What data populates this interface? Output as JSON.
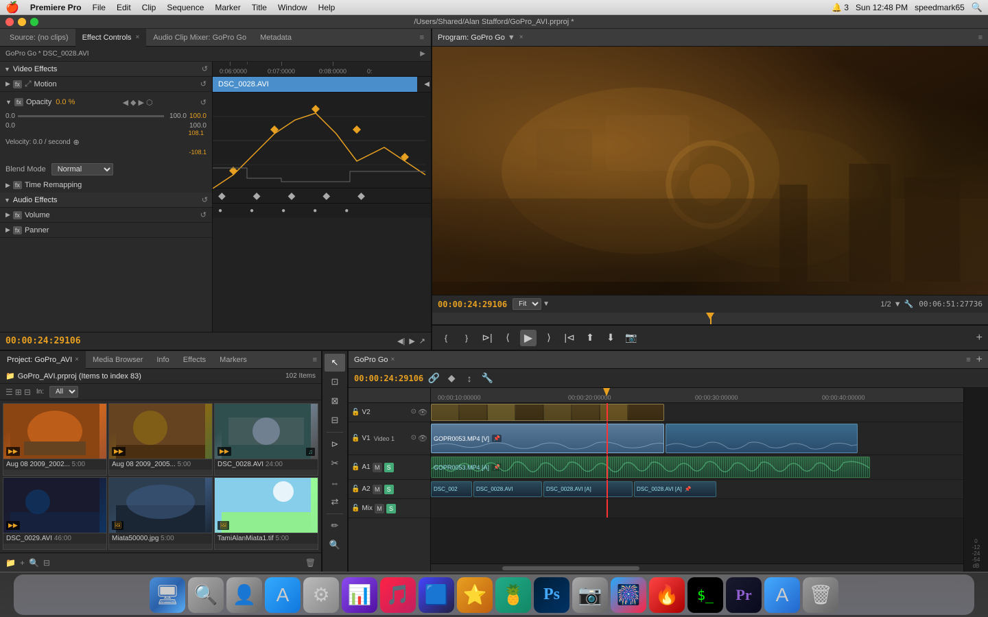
{
  "app": {
    "name": "Premiere Pro",
    "title_bar": "/Users/Shared/Alan Stafford/GoPro_AVI.prproj *",
    "time": "Sun 12:48 PM",
    "user": "speedmark65"
  },
  "menu": {
    "apple": "🍎",
    "items": [
      "Premiere Pro",
      "File",
      "Edit",
      "Clip",
      "Sequence",
      "Marker",
      "Title",
      "Window",
      "Help"
    ]
  },
  "effect_controls": {
    "tab_label": "Effect Controls",
    "tab_close": "×",
    "other_tabs": [
      "Source: (no clips)",
      "Audio Clip Mixer: GoPro Go",
      "Metadata"
    ],
    "source_label": "Source: (no clips)",
    "clip_name": "GoPro Go * DSC_0028.AVI",
    "timeline_clip": "DSC_0028.AVI",
    "video_effects_label": "Video Effects",
    "motion_label": "Motion",
    "opacity_label": "Opacity",
    "opacity_value": "0.0 %",
    "range_min": "0.0",
    "range_max": "100.0",
    "graph_max": "100.0",
    "graph_108": "108.1",
    "graph_neg108": "-108.1",
    "velocity_label": "Velocity: 0.0 / second",
    "blend_mode_label": "Blend Mode",
    "blend_mode_value": "Normal",
    "time_remap_label": "Time Remapping",
    "audio_effects_label": "Audio Effects",
    "volume_label": "Volume",
    "panner_label": "Panner",
    "timecode": "00:00:24:29106"
  },
  "program_monitor": {
    "title": "Program: GoPro Go",
    "timecode": "00:00:24:29106",
    "fit_label": "Fit",
    "fraction": "1/2",
    "duration": "00:06:51:27736"
  },
  "project": {
    "tab_label": "Project: GoPro_AVI",
    "tab_close": "×",
    "other_tabs": [
      "Media Browser",
      "Info",
      "Effects",
      "Markers"
    ],
    "project_name": "GoPro_AVI.prproj (Items to index 83)",
    "items_count": "102 Items",
    "in_label": "In:",
    "in_value": "All",
    "media_items": [
      {
        "name": "Aug 08 2009_2002...",
        "duration": "5:00",
        "thumb": "1",
        "has_audio": true
      },
      {
        "name": "Aug 08 2009_2005...",
        "duration": "5:00",
        "thumb": "2",
        "has_audio": true
      },
      {
        "name": "DSC_0028.AVI",
        "duration": "24:00",
        "thumb": "3",
        "has_audio": false
      },
      {
        "name": "DSC_0029.AVI",
        "duration": "46:00",
        "thumb": "4",
        "has_audio": false
      },
      {
        "name": "Miata50000.jpg",
        "duration": "5:00",
        "thumb": "5",
        "has_audio": false
      },
      {
        "name": "TamiAlanMiata1.tif",
        "duration": "5:00",
        "thumb": "6",
        "has_audio": false
      }
    ]
  },
  "timeline": {
    "tab_label": "GoPro Go",
    "tab_close": "×",
    "timecode": "00:00:24:29106",
    "ruler_marks": [
      "00:00:10:00000",
      "00:00:20:00000",
      "00:00:30:00000",
      "00:00:40:00000"
    ],
    "tracks": {
      "v2_label": "V2",
      "v1_label": "V1",
      "video1_label": "Video 1",
      "a1_label": "A1",
      "a2_label": "A2"
    },
    "clips": {
      "v1_main": "GOPR0053.MP4 [V]",
      "a1_main": "GOPR0053.MP4 [A]",
      "a2_clips": [
        "DSC_002",
        "DSC_0028.AVI",
        "DSC_0028.AVI [A]",
        "DSC_0028.AVI [A]"
      ]
    }
  },
  "tools": [
    "arrow",
    "select",
    "ripple",
    "roll",
    "rate",
    "razor",
    "slip",
    "slide",
    "pen",
    "zoom"
  ],
  "dock_apps": [
    {
      "name": "Finder",
      "icon": "🖥"
    },
    {
      "name": "Spotlight",
      "icon": "🔍"
    },
    {
      "name": "Contacts",
      "icon": "👤"
    },
    {
      "name": "App Store",
      "icon": "🅐"
    },
    {
      "name": "System Preferences",
      "icon": "⚙"
    },
    {
      "name": "Keynote",
      "icon": "📊"
    },
    {
      "name": "iTunes",
      "icon": "🎵"
    },
    {
      "name": "Squash",
      "icon": "🟦"
    },
    {
      "name": "Logic Pro",
      "icon": "⭐"
    },
    {
      "name": "Tropico",
      "icon": "🍍"
    },
    {
      "name": "Photoshop",
      "icon": "Ps"
    },
    {
      "name": "Camera",
      "icon": "📷"
    },
    {
      "name": "Photo Booth",
      "icon": "🎆"
    },
    {
      "name": "After Effects",
      "icon": "🔥"
    },
    {
      "name": "Terminal",
      "icon": "⬛"
    },
    {
      "name": "Premiere Pro",
      "icon": "Pr"
    },
    {
      "name": "Font Book",
      "icon": "🔤"
    },
    {
      "name": "Trash",
      "icon": "🗑"
    }
  ]
}
